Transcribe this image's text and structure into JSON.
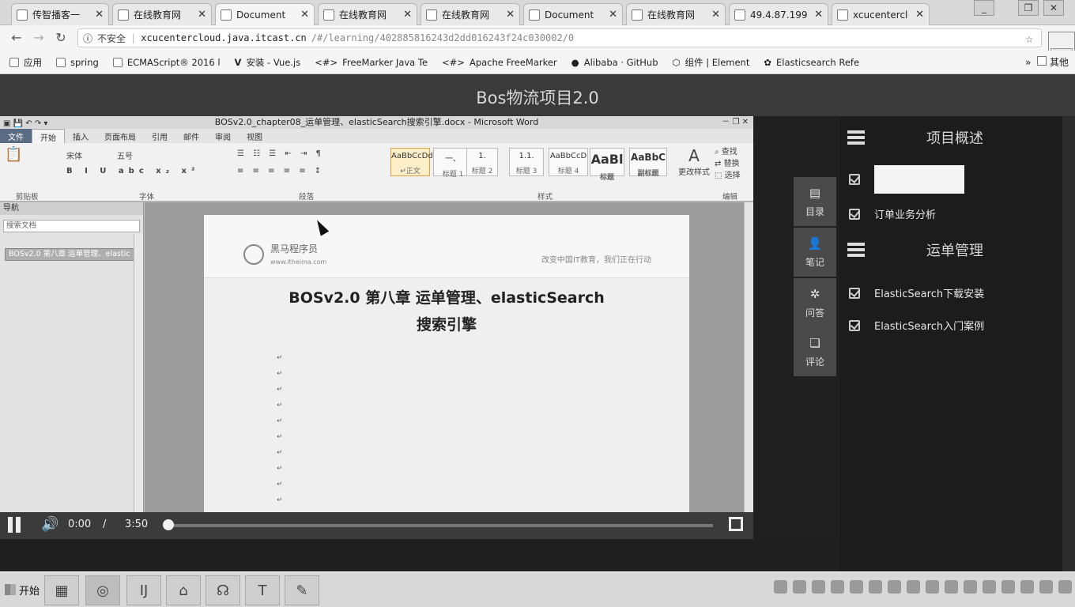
{
  "browser": {
    "tabs": [
      {
        "label": "传智播客一"
      },
      {
        "label": "在线教育网"
      },
      {
        "label": "Document"
      },
      {
        "label": "在线教育网"
      },
      {
        "label": "在线教育网"
      },
      {
        "label": "Document"
      },
      {
        "label": "在线教育网"
      },
      {
        "label": "49.4.87.199"
      },
      {
        "label": "xcucentercl"
      }
    ],
    "security_label": "不安全",
    "url_host": "xcucentercloud.java.itcast.cn",
    "url_path": "/#/learning/402885816243d2dd016243f24c030002/0",
    "start_popup_label": "开始",
    "bookmarks": [
      {
        "label": "应用"
      },
      {
        "label": "spring"
      },
      {
        "label": "ECMAScript® 2016 l"
      },
      {
        "label": "安装 - Vue.js"
      },
      {
        "label": "FreeMarker Java Te"
      },
      {
        "label": "Apache FreeMarker"
      },
      {
        "label": "Alibaba · GitHub"
      },
      {
        "label": "组件 | Element"
      },
      {
        "label": "Elasticsearch Refe"
      }
    ],
    "bookmarks_more": "其他"
  },
  "page": {
    "title": "Bos物流项目2.0",
    "sidebar_tabs": [
      {
        "label": "目录",
        "icon": "catalog-icon"
      },
      {
        "label": "笔记",
        "icon": "user-note-icon"
      },
      {
        "label": "问答",
        "icon": "gear-qa-icon"
      },
      {
        "label": "评论",
        "icon": "comment-icon"
      }
    ],
    "sections": [
      {
        "title": "项目概述",
        "lessons": [
          {
            "label": ""
          },
          {
            "label": "订单业务分析"
          }
        ]
      },
      {
        "title": "运单管理",
        "lessons": [
          {
            "label": "ElasticSearch下载安装"
          },
          {
            "label": "ElasticSearch入门案例"
          }
        ]
      }
    ]
  },
  "video": {
    "current_time": "0:00",
    "separator": "/",
    "duration": "3:50",
    "progress": 0.0
  },
  "word": {
    "window_title": "BOSv2.0_chapter08_运单管理、elasticSearch搜索引擎.docx - Microsoft Word",
    "ribbon_tabs": [
      "文件",
      "开始",
      "插入",
      "页面布局",
      "引用",
      "邮件",
      "审阅",
      "视图"
    ],
    "ribbon_groups": [
      "剪贴板",
      "字体",
      "段落",
      "样式",
      "编辑"
    ],
    "font_name": "宋体",
    "font_size": "五号",
    "styles": [
      {
        "preview": "AaBbCcDd",
        "name": "↵正文"
      },
      {
        "preview": "一、",
        "name": "标题 1"
      },
      {
        "preview": "1.",
        "name": "标题 2"
      },
      {
        "preview": "1.1.",
        "name": "标题 3"
      },
      {
        "preview": "AaBbCcD",
        "name": "标题 4"
      },
      {
        "preview": "AaBl",
        "name": "标题"
      },
      {
        "preview": "AaBbC",
        "name": "副标题"
      }
    ],
    "change_styles": "更改样式",
    "edit_find": "查找",
    "edit_replace": "替换",
    "edit_select": "选择",
    "nav_title": "导航",
    "nav_search": "搜索文档",
    "nav_item": "BOSv2.0 第八章 运单管理、elastic",
    "logo_name": "黑马程序员",
    "logo_sub": "www.itheima.com",
    "slogan": "改变中国IT教育，我们正在行动",
    "heading_line1": "BOSv2.0  第八章  运单管理、elasticSearch",
    "heading_line2": "搜索引擎",
    "paragraph_mark": "↵"
  },
  "taskbar": {
    "start_label": "开始"
  }
}
